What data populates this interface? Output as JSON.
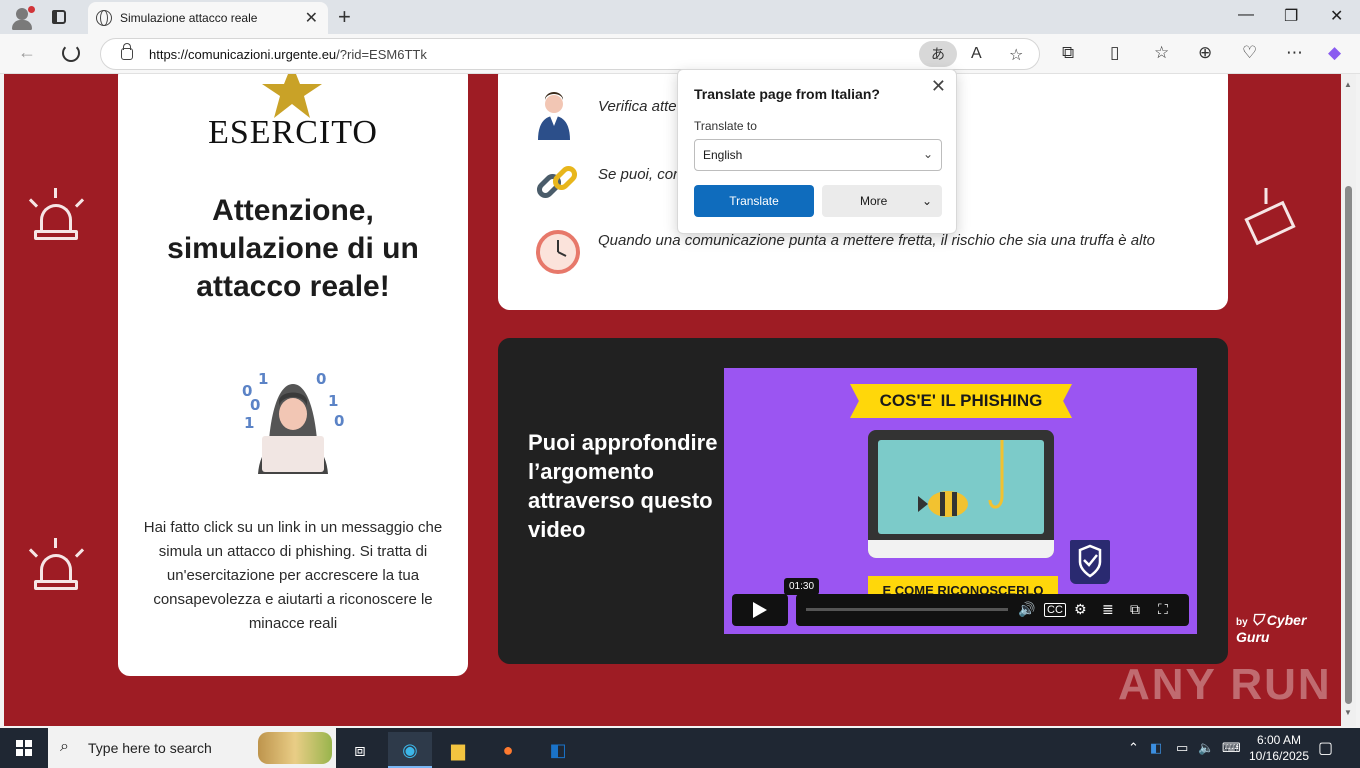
{
  "browser": {
    "tab_title": "Simulazione attacco reale",
    "url_host": "https://comunicazioni.urgente.eu",
    "url_path": "/?rid=ESM6TTk",
    "translate_pill": "あ",
    "window_controls": [
      "—",
      "❐",
      "✕"
    ]
  },
  "page": {
    "brand": "ESERCITO",
    "headline": "Attenzione, simulazione di un attacco reale!",
    "description": "Hai fatto click su un link in un messaggio che simula un attacco di phishing. Si tratta di un'esercitazione per accrescere la tua consapevolezza e aiutarti a riconoscere le minacce reali",
    "tips": [
      {
        "icon": "person-icon",
        "text": "Verifica atte"
      },
      {
        "icon": "link-icon",
        "text": "Se puoi, cor"
      },
      {
        "icon": "clock-icon",
        "text": "Quando una comunicazione punta a mettere fretta, il rischio che sia una truffa è alto"
      }
    ],
    "video_title": "Puoi approfondire l’argomento attraverso questo video",
    "video": {
      "banner_top": "COS'E' IL PHISHING",
      "banner_bottom": "E COME RICONOSCERLO",
      "timestamp": "01:30"
    },
    "powered_by": "by",
    "cyber_brand": "Cyber Guru"
  },
  "translate_popup": {
    "title": "Translate page from Italian?",
    "label": "Translate to",
    "selected_language": "English",
    "translate_button": "Translate",
    "more_button": "More"
  },
  "taskbar": {
    "search_placeholder": "Type here to search",
    "time": "6:00 AM",
    "date": "10/16/2025"
  },
  "watermark": "ANY RUN",
  "colors": {
    "page_bg": "#9e1c24",
    "accent_blue": "#0f6cbd",
    "video_bg": "#9b55f2",
    "banner_yellow": "#ffd70a"
  }
}
